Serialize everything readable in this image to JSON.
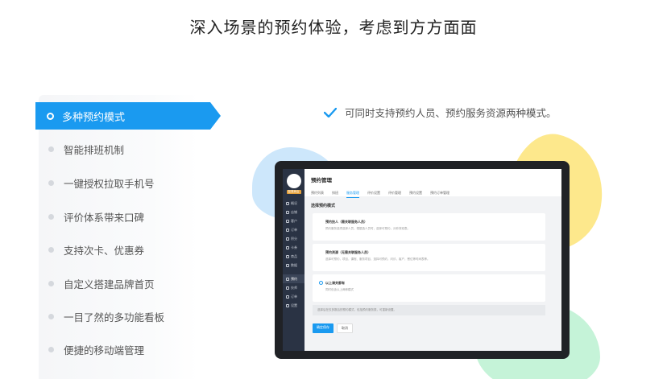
{
  "headline": "深入场景的预约体验，考虑到方方面面",
  "features": [
    {
      "label": "多种预约模式",
      "active": true
    },
    {
      "label": "智能排班机制"
    },
    {
      "label": "一键授权拉取手机号"
    },
    {
      "label": "评价体系带来口碑"
    },
    {
      "label": "支持次卡、优惠券"
    },
    {
      "label": "自定义搭建品牌首页"
    },
    {
      "label": "一目了然的多功能看板"
    },
    {
      "label": "便捷的移动端管理"
    }
  ],
  "feature_detail": "可同时支持预约人员、预约服务资源两种模式。",
  "colors": {
    "accent": "#1a9af0",
    "blob_blue": "#cde7fb",
    "blob_yellow": "#fde88c",
    "blob_green": "#c5f3d8"
  },
  "app": {
    "logo_tag": "智慧商店",
    "sidebar": [
      {
        "icon": "home-icon",
        "label": "概况"
      },
      {
        "icon": "store-icon",
        "label": "店铺"
      },
      {
        "icon": "customer-icon",
        "label": "客户"
      },
      {
        "icon": "order-icon",
        "label": "订单"
      },
      {
        "icon": "points-icon",
        "label": "积分"
      },
      {
        "icon": "card-icon",
        "label": "卡券"
      },
      {
        "icon": "goods-icon",
        "label": "商品"
      },
      {
        "icon": "data-icon",
        "label": "数据"
      },
      {
        "icon": "booking-icon",
        "label": "预约",
        "selected": true
      },
      {
        "icon": "staff-icon",
        "label": "技师"
      },
      {
        "icon": "finance-icon",
        "label": "订单"
      },
      {
        "icon": "settings-icon",
        "label": "设置"
      }
    ],
    "title": "预约管理",
    "tabs": [
      "预约列表",
      "排班",
      "服务管理",
      "评价设置",
      "评价管理",
      "预约设置",
      "预约订单管理"
    ],
    "active_tab": 2,
    "section_title": "选择预约模式",
    "cards": [
      {
        "title": "预约技人（需关联服务人员）",
        "desc": "预约服务选项选择人员，根据选人员时，选择可预约，分秒排班表。"
      },
      {
        "title": "预约资源（无需关联服务人员）",
        "desc": "选择可预约，项目，课程、服务项目、选择可预约，问诊，客户，餐位等时间表等。"
      },
      {
        "title": "以上请关都有",
        "desc": "同时包含以上两种模式"
      }
    ],
    "note": "选择后在仅多数后的预约模式，包括预约服务类，可重新设置。",
    "buttons": {
      "save": "确定保存",
      "cancel": "取消"
    }
  }
}
